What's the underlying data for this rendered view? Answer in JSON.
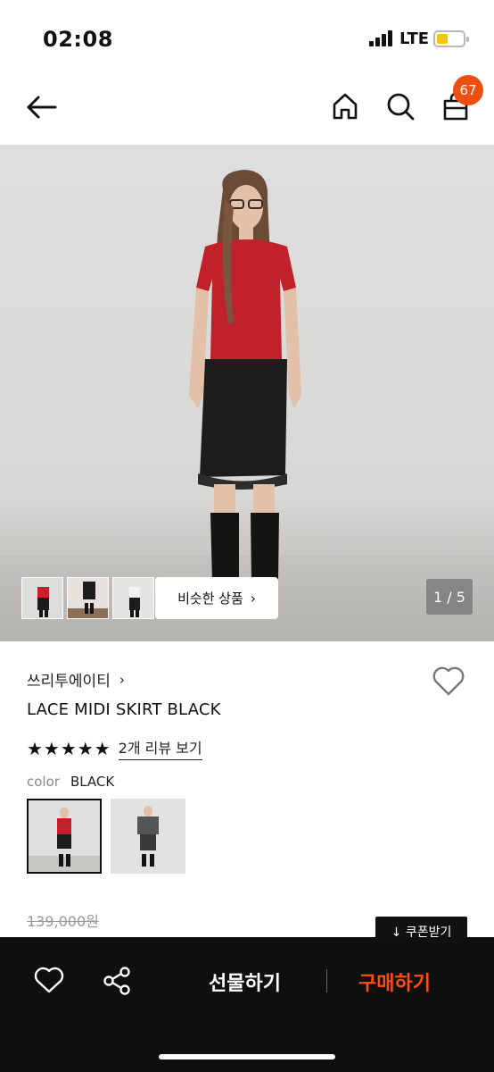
{
  "status_bar": {
    "time": "02:08",
    "network": "LTE"
  },
  "nav": {
    "cart_count": "67"
  },
  "gallery": {
    "similar_label": "비슷한 상품",
    "similar_chevron": "›",
    "pager": "1 / 5"
  },
  "product": {
    "brand": "쓰리투에이티",
    "brand_chevron": "›",
    "name": "LACE MIDI SKIRT BLACK",
    "stars": "★★★★★",
    "reviews_link": "2개 리뷰 보기",
    "color_label": "color",
    "color_value": "BLACK",
    "original_price": "139,000원",
    "coupon_button": "↓ 쿠폰받기"
  },
  "bottom_bar": {
    "gift_label": "선물하기",
    "buy_label": "구매하기"
  },
  "colors": {
    "accent": "#f04e0f",
    "buy": "#ff4d12",
    "bar": "#0f0f0f"
  }
}
